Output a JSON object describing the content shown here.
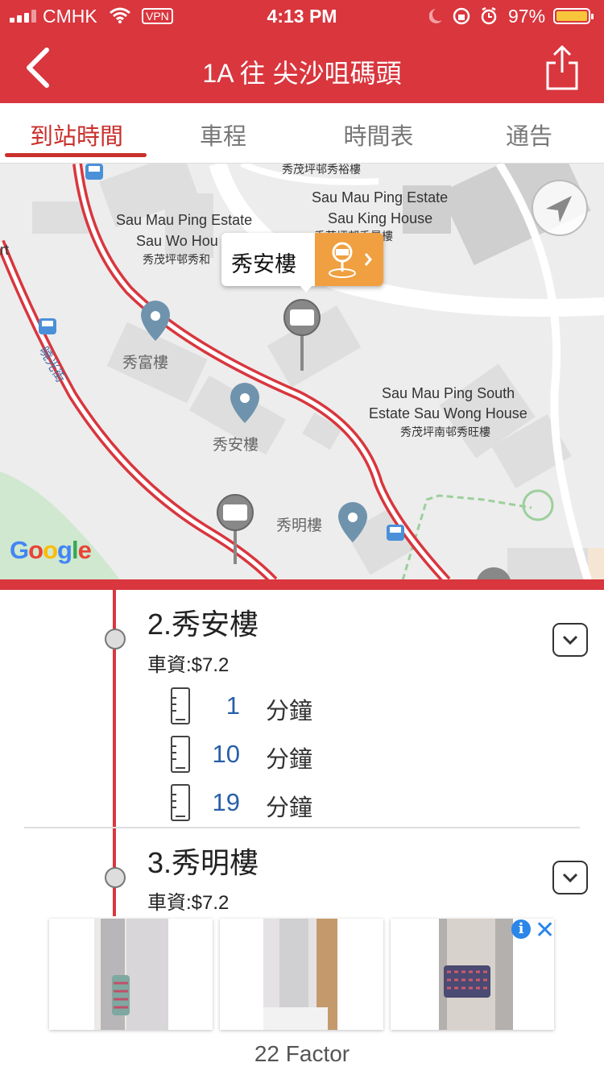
{
  "status_bar": {
    "carrier": "CMHK",
    "vpn": "VPN",
    "time": "4:13 PM",
    "battery": "97%",
    "battery_level": 0.97
  },
  "header": {
    "title": "1A 往 尖沙咀碼頭",
    "back_icon": "chevron-left-icon",
    "share_icon": "share-icon"
  },
  "tabs": [
    {
      "label": "到站時間",
      "active": true
    },
    {
      "label": "車程",
      "active": false
    },
    {
      "label": "時間表",
      "active": false
    },
    {
      "label": "通告",
      "active": false
    }
  ],
  "map": {
    "labels": {
      "sau_yue": "秀茂坪邨秀裕樓",
      "estate1": "Sau Mau Ping Estate",
      "king_house": "Sau King House",
      "king_cn": "秀茂坪邨秀景樓",
      "estate2": "Sau Mau Ping Estate",
      "wo_house": "Sau Wo Hou",
      "wo_cn": "秀茂坪邨秀和",
      "sau_fu": "秀富樓",
      "sau_on": "秀安樓",
      "sau_ming": "秀明樓",
      "south1": "Sau Mau Ping South",
      "south2": "Estate Sau Wong House",
      "south_cn": "秀茂坪南邨秀旺樓",
      "road": "曉光街",
      "edge": "rt"
    },
    "callout_name": "秀安樓",
    "google": "Google"
  },
  "stops": [
    {
      "name": "2.秀安樓",
      "fare": "車資:$7.2",
      "etas": [
        {
          "minutes": "1",
          "unit": "分鐘"
        },
        {
          "minutes": "10",
          "unit": "分鐘"
        },
        {
          "minutes": "19",
          "unit": "分鐘"
        }
      ]
    },
    {
      "name": "3.秀明樓",
      "fare": "車資:$7.2"
    }
  ],
  "ad": {
    "info": "i",
    "close": "✕",
    "brand": "22 Factor"
  },
  "colors": {
    "brand_red": "#d9363e",
    "eta_blue": "#2860a8",
    "callout_orange": "#f0a040"
  }
}
